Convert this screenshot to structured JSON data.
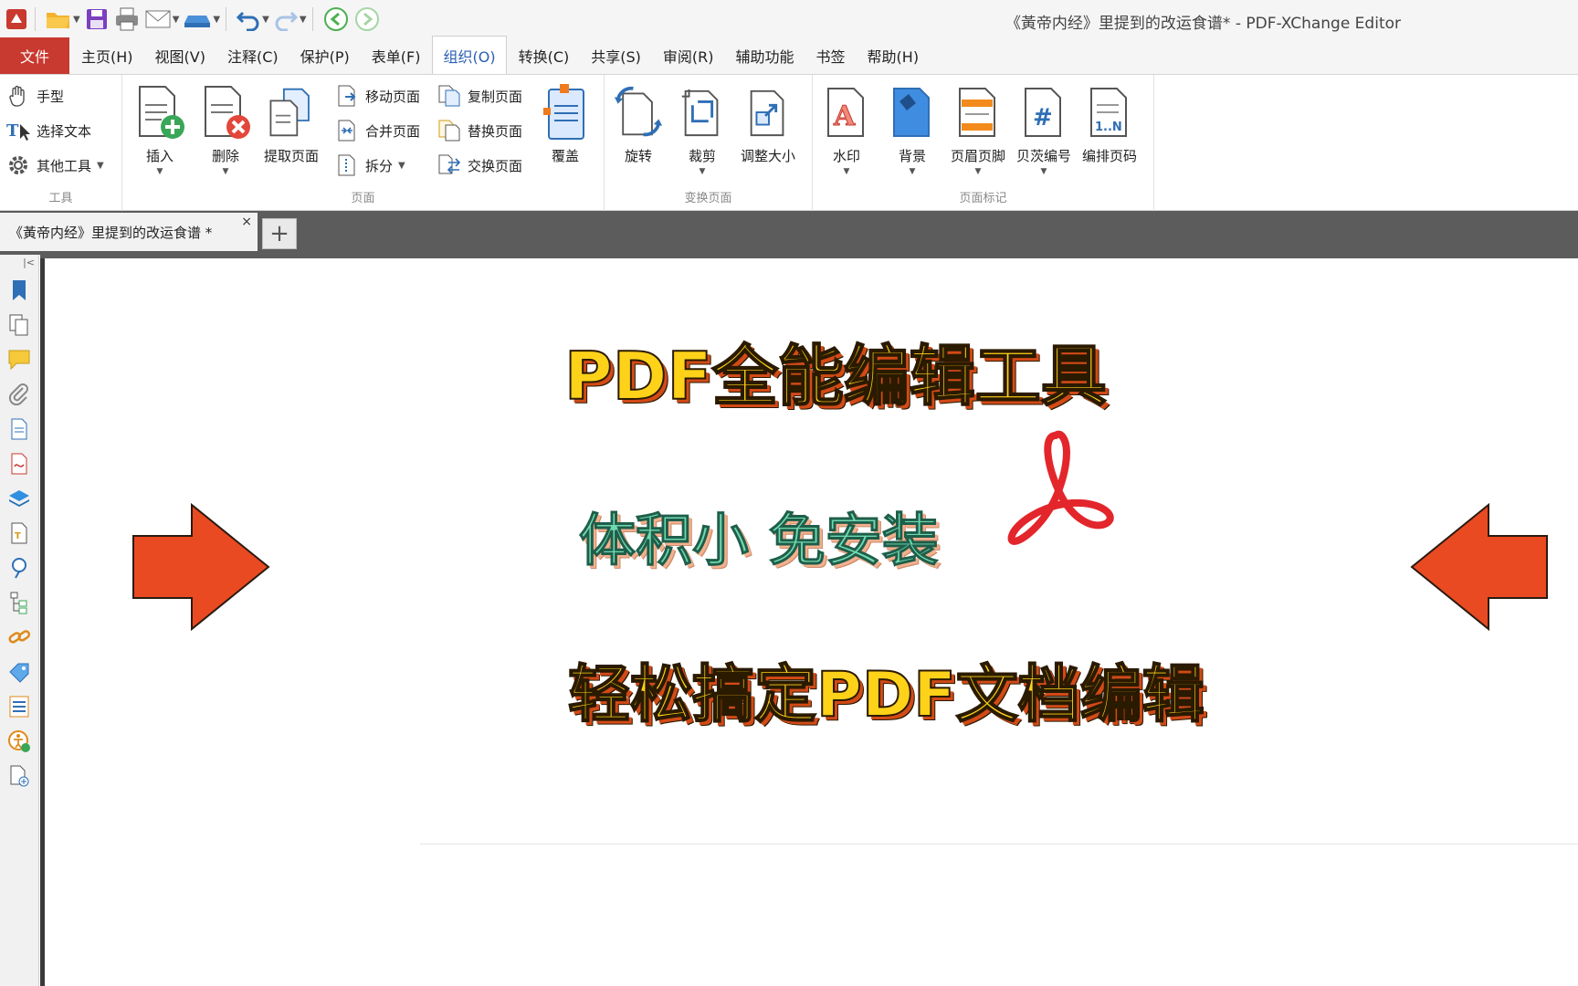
{
  "window": {
    "title": "《黃帝内经》里提到的改运食谱* - PDF-XChange Editor"
  },
  "menu": {
    "file": "文件",
    "tabs": [
      "主页(H)",
      "视图(V)",
      "注释(C)",
      "保护(P)",
      "表单(F)",
      "组织(O)",
      "转换(C)",
      "共享(S)",
      "审阅(R)",
      "辅助功能",
      "书签",
      "帮助(H)"
    ],
    "active_index": 5
  },
  "ribbon": {
    "tools": {
      "label": "工具",
      "hand": "手型",
      "select_text": "选择文本",
      "other_tools": "其他工具"
    },
    "pages": {
      "label": "页面",
      "insert": "插入",
      "delete": "删除",
      "extract": "提取页面",
      "move": "移动页面",
      "merge": "合并页面",
      "split": "拆分",
      "copy": "复制页面",
      "replace": "替换页面",
      "swap": "交换页面",
      "overlay": "覆盖"
    },
    "transform": {
      "label": "变换页面",
      "rotate": "旋转",
      "crop": "裁剪",
      "resize": "调整大小"
    },
    "marks": {
      "label": "页面标记",
      "watermark": "水印",
      "background": "背景",
      "header_footer": "页眉页脚",
      "bates": "贝茨编号",
      "number_pages": "编排页码"
    }
  },
  "doc_tab": {
    "title": "《黃帝内经》里提到的改运食谱 *",
    "close": "×",
    "new": "+"
  },
  "content": {
    "headline1": "PDF全能编辑工具",
    "headline2": "体积小 免安装",
    "headline3": "轻松搞定PDF文档编辑"
  },
  "colors": {
    "accent_red": "#c8392f",
    "arrow": "#ea4a22",
    "active_tab_text": "#2b5fb5"
  },
  "icons": [
    "hand-icon",
    "select-text-icon",
    "gear-icon",
    "bookmark-icon",
    "pages-icon",
    "comment-icon",
    "attachment-icon",
    "layers-icon",
    "link-icon",
    "acrobat-logo-icon"
  ]
}
